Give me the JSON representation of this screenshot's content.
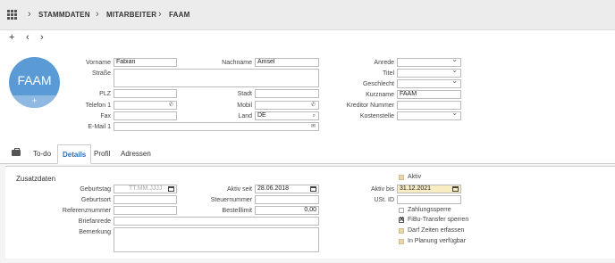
{
  "breadcrumb": {
    "items": [
      "STAMMDATEN",
      "MITARBEITER",
      "FAAM"
    ]
  },
  "toolbar": {
    "add": "+",
    "back": "‹",
    "forward": "›"
  },
  "avatar": {
    "initials": "FAAM",
    "add": "+",
    "color": "#5b9bd5"
  },
  "header_form": {
    "vorname": {
      "label": "Vorname",
      "value": "Fabian"
    },
    "nachname": {
      "label": "Nachname",
      "value": "Amsel"
    },
    "strasse": {
      "label": "Straße",
      "value": ""
    },
    "plz": {
      "label": "PLZ",
      "value": ""
    },
    "stadt": {
      "label": "Stadt",
      "value": ""
    },
    "telefon1": {
      "label": "Telefon 1",
      "value": ""
    },
    "mobil": {
      "label": "Mobil",
      "value": ""
    },
    "fax": {
      "label": "Fax",
      "value": ""
    },
    "land": {
      "label": "Land",
      "value": "DE"
    },
    "email1": {
      "label": "E-Mail 1",
      "value": ""
    },
    "anrede": {
      "label": "Anrede",
      "value": ""
    },
    "titel": {
      "label": "Titel",
      "value": ""
    },
    "geschlecht": {
      "label": "Geschlecht",
      "value": ""
    },
    "kurzname": {
      "label": "Kurzname",
      "value": "FAAM"
    },
    "kreditor": {
      "label": "Kreditor Nummer",
      "value": ""
    },
    "kostenstelle": {
      "label": "Kostenstelle",
      "value": ""
    }
  },
  "tabs": [
    {
      "label": "To-do"
    },
    {
      "label": "Details",
      "active": true
    },
    {
      "label": "Profil"
    },
    {
      "label": "Adressen"
    }
  ],
  "zusatzdaten": {
    "title": "Zusatzdaten",
    "geburtstag": {
      "label": "Geburtstag",
      "placeholder": "TT.MM.JJJJ"
    },
    "geburtsort": {
      "label": "Geburtsort",
      "value": ""
    },
    "referenznummer": {
      "label": "Referenznummer",
      "value": ""
    },
    "briefanrede": {
      "label": "Briefanrede",
      "value": ""
    },
    "bemerkung": {
      "label": "Bemerkung",
      "value": ""
    },
    "aktiv_seit": {
      "label": "Aktiv seit",
      "value": "28.06.2018"
    },
    "steuernummer": {
      "label": "Steuernummer",
      "value": ""
    },
    "bestelllimit": {
      "label": "Bestelllimit",
      "value": "0,00"
    },
    "aktiv": {
      "label": "Aktiv"
    },
    "aktiv_bis": {
      "label": "Aktiv bis",
      "value": "31.12.2021"
    },
    "ust_id": {
      "label": "USt. ID",
      "value": ""
    },
    "zahlungssperre": {
      "label": "Zahlungssperre"
    },
    "fibu": {
      "label": "FiBu-Transfer sperren",
      "mark": "X"
    },
    "darf_zeiten": {
      "label": "Darf Zeiten erfassen"
    },
    "in_planung": {
      "label": "In Planung verfügbar"
    }
  }
}
